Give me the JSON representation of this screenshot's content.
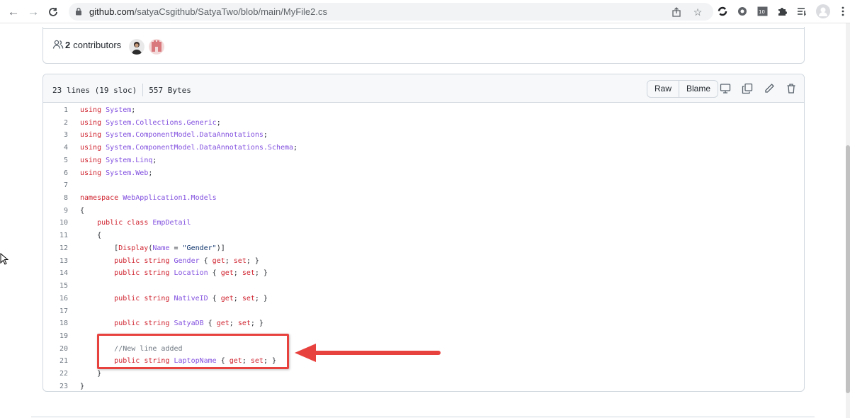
{
  "browser": {
    "url_host": "github.com",
    "url_path": "/satyaCsgithub/SatyaTwo/blob/main/MyFile2.cs",
    "icons": [
      "back-icon",
      "forward-icon",
      "reload-icon",
      "lock-icon",
      "share-icon",
      "star-icon",
      "extension-icons",
      "puzzle-icon",
      "reading-list-icon",
      "profile-icon",
      "menu-icon"
    ]
  },
  "contributors": {
    "count": "2",
    "label": "contributors"
  },
  "file": {
    "lines_info": "23 lines (19 sloc)",
    "size": "557 Bytes",
    "raw_label": "Raw",
    "blame_label": "Blame"
  },
  "code_lines": [
    {
      "n": "1",
      "t": [
        [
          "kw",
          "using"
        ],
        [
          "pl",
          " "
        ],
        [
          "ty",
          "System"
        ],
        [
          "pl",
          ";"
        ]
      ]
    },
    {
      "n": "2",
      "t": [
        [
          "kw",
          "using"
        ],
        [
          "pl",
          " "
        ],
        [
          "ty",
          "System.Collections.Generic"
        ],
        [
          "pl",
          ";"
        ]
      ]
    },
    {
      "n": "3",
      "t": [
        [
          "kw",
          "using"
        ],
        [
          "pl",
          " "
        ],
        [
          "ty",
          "System.ComponentModel.DataAnnotations"
        ],
        [
          "pl",
          ";"
        ]
      ]
    },
    {
      "n": "4",
      "t": [
        [
          "kw",
          "using"
        ],
        [
          "pl",
          " "
        ],
        [
          "ty",
          "System.ComponentModel.DataAnnotations.Schema"
        ],
        [
          "pl",
          ";"
        ]
      ]
    },
    {
      "n": "5",
      "t": [
        [
          "kw",
          "using"
        ],
        [
          "pl",
          " "
        ],
        [
          "ty",
          "System.Linq"
        ],
        [
          "pl",
          ";"
        ]
      ]
    },
    {
      "n": "6",
      "t": [
        [
          "kw",
          "using"
        ],
        [
          "pl",
          " "
        ],
        [
          "ty",
          "System.Web"
        ],
        [
          "pl",
          ";"
        ]
      ]
    },
    {
      "n": "7",
      "t": []
    },
    {
      "n": "8",
      "t": [
        [
          "kw",
          "namespace"
        ],
        [
          "pl",
          " "
        ],
        [
          "ty",
          "WebApplication1.Models"
        ]
      ]
    },
    {
      "n": "9",
      "t": [
        [
          "pl",
          "{"
        ]
      ]
    },
    {
      "n": "10",
      "t": [
        [
          "pl",
          "    "
        ],
        [
          "kw",
          "public"
        ],
        [
          "pl",
          " "
        ],
        [
          "kw",
          "class"
        ],
        [
          "pl",
          " "
        ],
        [
          "ty",
          "EmpDetail"
        ]
      ]
    },
    {
      "n": "11",
      "t": [
        [
          "pl",
          "    {"
        ]
      ]
    },
    {
      "n": "12",
      "t": [
        [
          "pl",
          "        ["
        ],
        [
          "kw",
          "Display"
        ],
        [
          "pl",
          "("
        ],
        [
          "ty",
          "Name"
        ],
        [
          "pl",
          " = "
        ],
        [
          "st",
          "\"Gender\""
        ],
        [
          "pl",
          ")]"
        ]
      ]
    },
    {
      "n": "13",
      "t": [
        [
          "pl",
          "        "
        ],
        [
          "kw",
          "public"
        ],
        [
          "pl",
          " "
        ],
        [
          "kw",
          "string"
        ],
        [
          "pl",
          " "
        ],
        [
          "ty",
          "Gender"
        ],
        [
          "pl",
          " { "
        ],
        [
          "kw",
          "get"
        ],
        [
          "pl",
          "; "
        ],
        [
          "kw",
          "set"
        ],
        [
          "pl",
          "; }"
        ]
      ]
    },
    {
      "n": "14",
      "t": [
        [
          "pl",
          "        "
        ],
        [
          "kw",
          "public"
        ],
        [
          "pl",
          " "
        ],
        [
          "kw",
          "string"
        ],
        [
          "pl",
          " "
        ],
        [
          "ty",
          "Location"
        ],
        [
          "pl",
          " { "
        ],
        [
          "kw",
          "get"
        ],
        [
          "pl",
          "; "
        ],
        [
          "kw",
          "set"
        ],
        [
          "pl",
          "; }"
        ]
      ]
    },
    {
      "n": "15",
      "t": []
    },
    {
      "n": "16",
      "t": [
        [
          "pl",
          "        "
        ],
        [
          "kw",
          "public"
        ],
        [
          "pl",
          " "
        ],
        [
          "kw",
          "string"
        ],
        [
          "pl",
          " "
        ],
        [
          "ty",
          "NativeID"
        ],
        [
          "pl",
          " { "
        ],
        [
          "kw",
          "get"
        ],
        [
          "pl",
          "; "
        ],
        [
          "kw",
          "set"
        ],
        [
          "pl",
          "; }"
        ]
      ]
    },
    {
      "n": "17",
      "t": []
    },
    {
      "n": "18",
      "t": [
        [
          "pl",
          "        "
        ],
        [
          "kw",
          "public"
        ],
        [
          "pl",
          " "
        ],
        [
          "kw",
          "string"
        ],
        [
          "pl",
          " "
        ],
        [
          "ty",
          "SatyaDB"
        ],
        [
          "pl",
          " { "
        ],
        [
          "kw",
          "get"
        ],
        [
          "pl",
          "; "
        ],
        [
          "kw",
          "set"
        ],
        [
          "pl",
          "; }"
        ]
      ]
    },
    {
      "n": "19",
      "t": []
    },
    {
      "n": "20",
      "t": [
        [
          "pl",
          "        "
        ],
        [
          "cm",
          "//New line added"
        ]
      ]
    },
    {
      "n": "21",
      "t": [
        [
          "pl",
          "        "
        ],
        [
          "kw",
          "public"
        ],
        [
          "pl",
          " "
        ],
        [
          "kw",
          "string"
        ],
        [
          "pl",
          " "
        ],
        [
          "ty",
          "LaptopName"
        ],
        [
          "pl",
          " { "
        ],
        [
          "kw",
          "get"
        ],
        [
          "pl",
          "; "
        ],
        [
          "kw",
          "set"
        ],
        [
          "pl",
          "; }"
        ]
      ]
    },
    {
      "n": "22",
      "t": [
        [
          "pl",
          "    }"
        ]
      ]
    },
    {
      "n": "23",
      "t": [
        [
          "pl",
          "}"
        ]
      ]
    }
  ],
  "colors": {
    "annotation": "#e8423f",
    "keyword": "#cf222e",
    "type": "#8250df"
  }
}
